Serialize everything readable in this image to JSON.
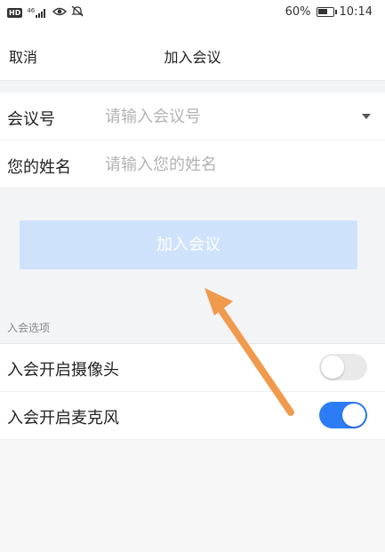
{
  "status_bar": {
    "network": "46",
    "battery": "60%",
    "time": "10:14"
  },
  "nav": {
    "cancel": "取消",
    "title": "加入会议"
  },
  "form": {
    "meeting_id": {
      "label": "会议号",
      "value": "",
      "placeholder": "请输入会议号"
    },
    "name": {
      "label": "您的姓名",
      "value": "",
      "placeholder": "请输入您的姓名"
    }
  },
  "join_button": {
    "label": "加入会议",
    "color": "#cfe2fc"
  },
  "options": {
    "section_label": "入会选项",
    "items": [
      {
        "label": "入会开启摄像头",
        "on": false
      },
      {
        "label": "入会开启麦克风",
        "on": true
      }
    ]
  },
  "colors": {
    "accent": "#2c7cf6",
    "annotation_arrow": "#f09a4e"
  },
  "icons": [
    "hd-icon",
    "signal-icon",
    "eye-icon",
    "silent-bell-icon",
    "battery-icon",
    "dropdown-caret-icon"
  ]
}
